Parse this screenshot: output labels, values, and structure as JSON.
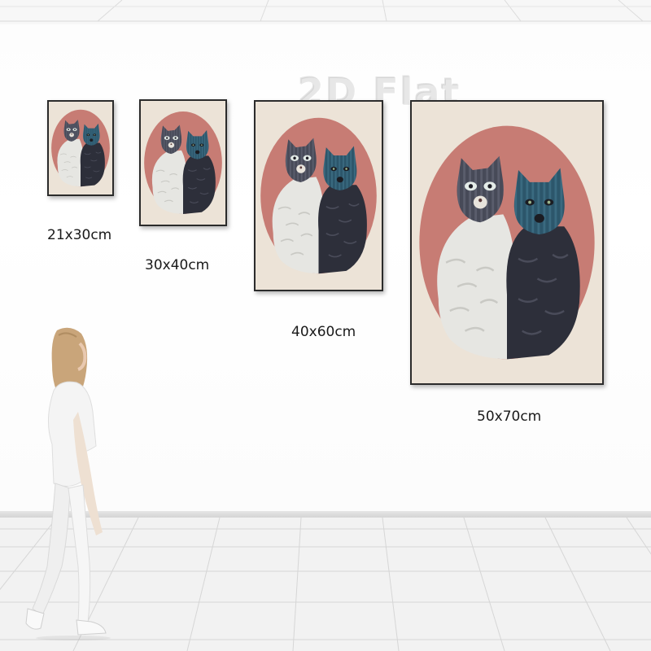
{
  "watermark": "2D Flat",
  "paintings": [
    {
      "size_label": "21x30cm"
    },
    {
      "size_label": "30x40cm"
    },
    {
      "size_label": "40x60cm"
    },
    {
      "size_label": "50x70cm"
    }
  ],
  "colors": {
    "canvas": "#ece3d7",
    "oval": "#c77c74",
    "white_cat": "#e8e8e4",
    "black_cat": "#2d2f3a",
    "grey_mask": "#4d4f5c",
    "blue_mask": "#2f5a70",
    "wall": "#ffffff",
    "floor": "#f1f1f1"
  }
}
